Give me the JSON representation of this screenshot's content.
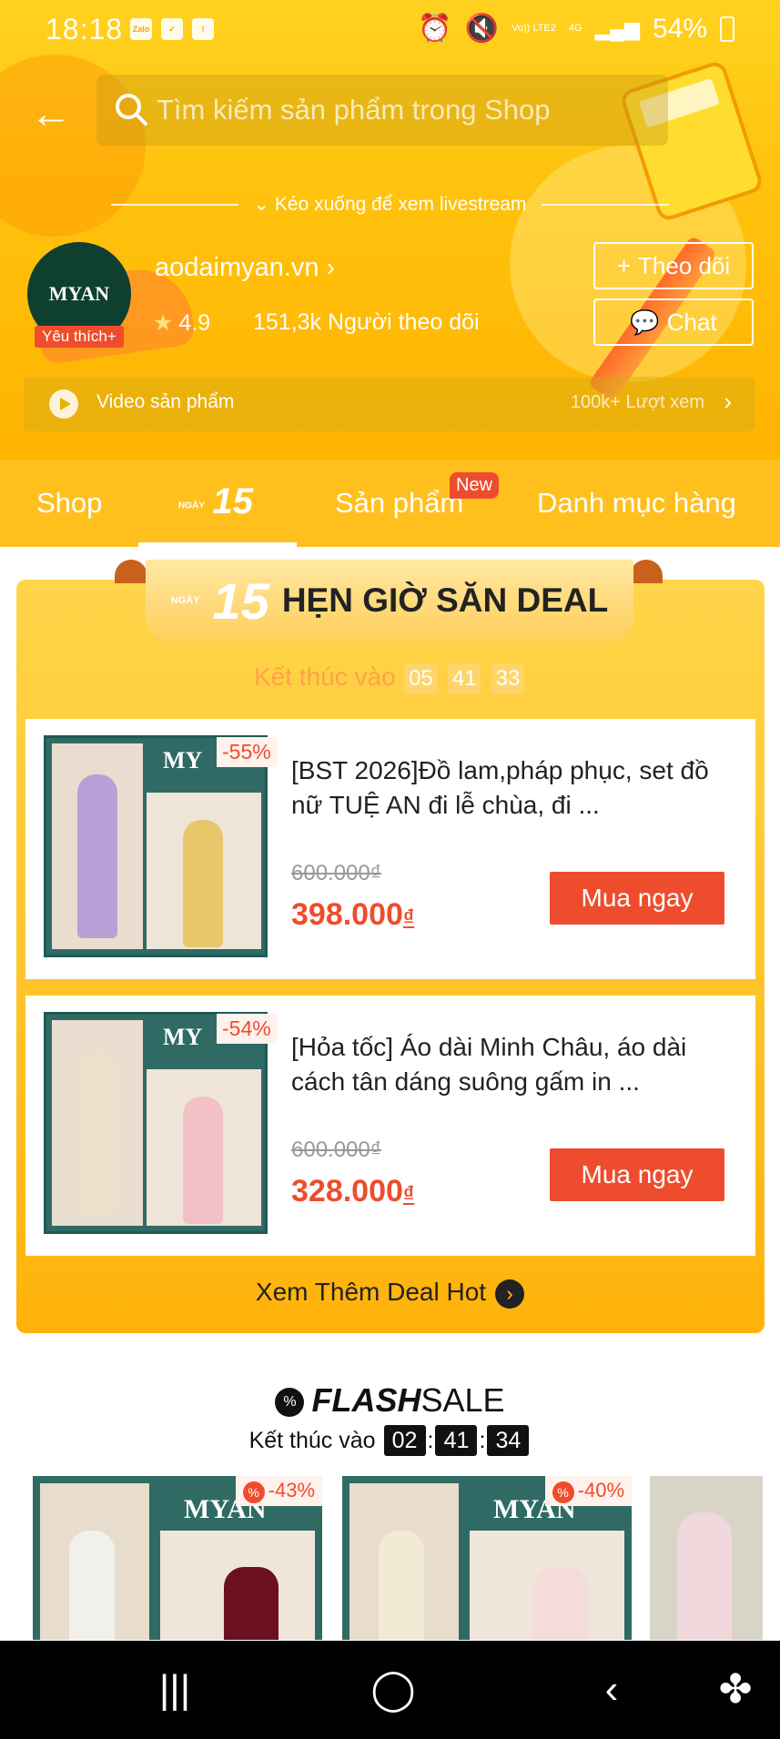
{
  "status_bar": {
    "time": "18:18",
    "battery": "54%",
    "network": "4G",
    "volte": "Vo))\nLTE2",
    "notif_icons": [
      "Zalo",
      "✓",
      "!"
    ]
  },
  "header": {
    "search_placeholder": "Tìm kiếm sản phẩm trong Shop",
    "scroll_hint": "Kéo xuống để xem livestream",
    "back_icon": "arrow-left-icon"
  },
  "shop": {
    "avatar_text": "MYAN",
    "badge": "Yêu thích+",
    "name": "aodaimyan.vn",
    "rating": "4.9",
    "followers": "151,3k Người theo dõi",
    "follow_label": "Theo dõi",
    "chat_label": "Chat"
  },
  "video_bar": {
    "label": "Video sản phẩm",
    "views": "100k+ Lượt xem"
  },
  "tabs": {
    "shop": "Shop",
    "day_prefix": "NGÀY",
    "day_number": "15",
    "products": "Sản phẩm",
    "new_badge": "New",
    "categories": "Danh mục hàng"
  },
  "deal": {
    "title_prefix": "NGÀY",
    "title_number": "15",
    "title": "HẸN GIỜ SĂN DEAL",
    "ends_label": "Kết thúc vào",
    "hours": "05",
    "minutes": "41",
    "seconds": "33",
    "items": [
      {
        "brand": "MY",
        "discount": "-55%",
        "name": "[BST 2026]Đồ lam,pháp phục, set đồ nữ  TUỆ AN đi lễ chùa, đi ...",
        "old_price": "600.000₫",
        "price": "398.000",
        "currency": "₫",
        "buy_label": "Mua ngay"
      },
      {
        "brand": "MY",
        "discount": "-54%",
        "name": "[Hỏa tốc] Áo dài Minh Châu, áo dài cách tân dáng suông gấm in ...",
        "old_price": "600.000₫",
        "price": "328.000",
        "currency": "₫",
        "buy_label": "Mua ngay"
      }
    ],
    "see_more": "Xem Thêm Deal Hot"
  },
  "flash_sale": {
    "title_flash": "FLASH",
    "title_sale": "SALE",
    "ends_label": "Kết thúc vào",
    "hours": "02",
    "minutes": "41",
    "seconds": "34",
    "items": [
      {
        "brand": "MYAN",
        "discount": "-43%",
        "pct": "%"
      },
      {
        "brand": "MYAN",
        "discount": "-40%",
        "pct": "%"
      }
    ]
  },
  "colors": {
    "banner": "#ffc20e",
    "accent": "#ee4d2d",
    "teal": "#2f6b64"
  }
}
